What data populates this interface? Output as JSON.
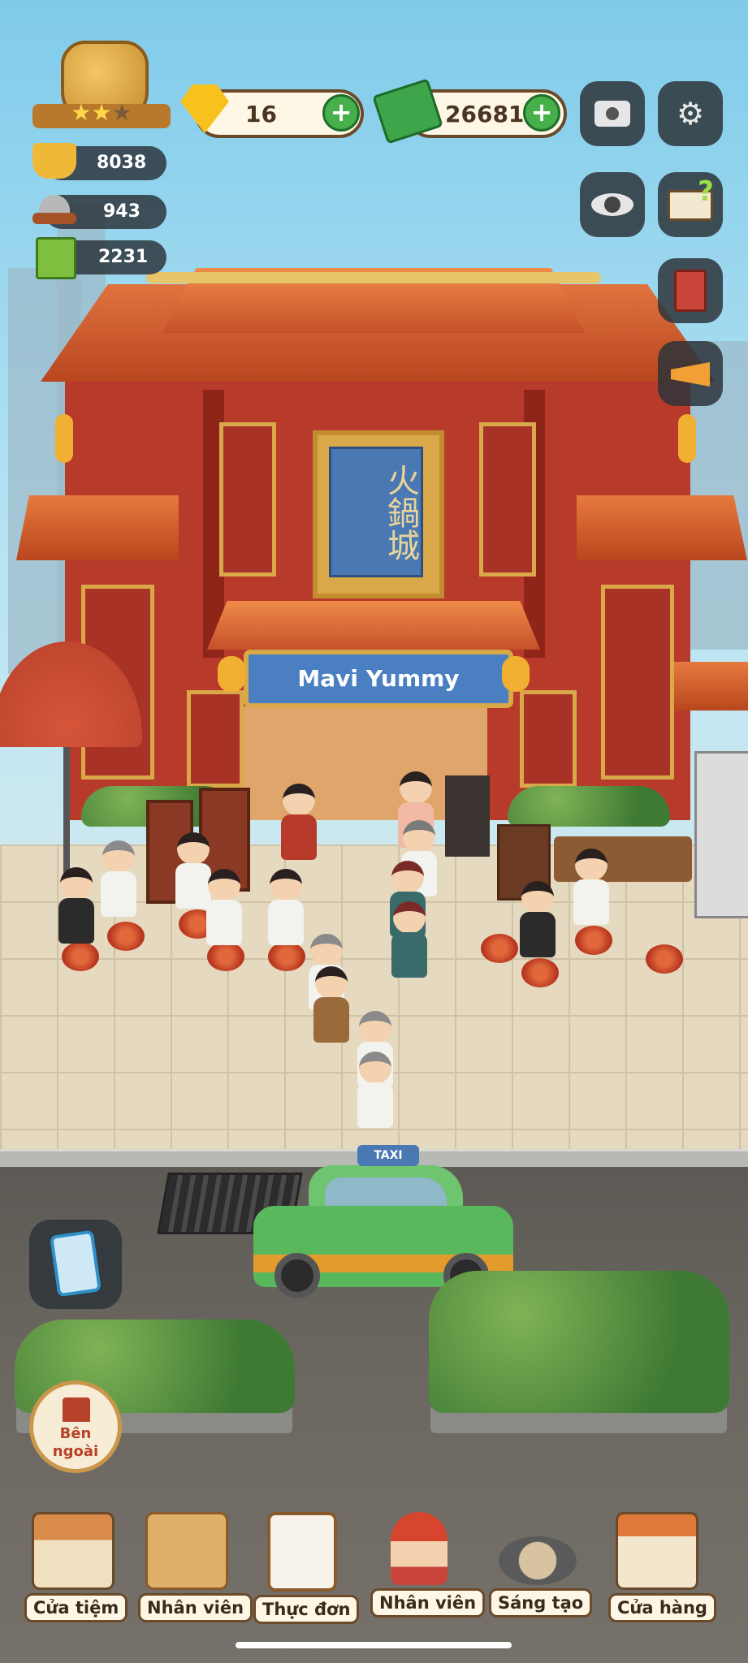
{
  "hud": {
    "diamonds": "16",
    "cash": "26681",
    "stat_hotpot": "8038",
    "stat_dish": "943",
    "stat_recipes": "2231"
  },
  "restaurant": {
    "name": "Mavi Yummy",
    "plaque": "火鍋城"
  },
  "taxi_label": "TAXI",
  "outside_button": {
    "label_line1": "Bên",
    "label_line2": "ngoài"
  },
  "bottom_nav": [
    {
      "label": "Cửa tiệm",
      "icon": "shop-building-icon"
    },
    {
      "label": "Nhân viên",
      "icon": "boxes-icon"
    },
    {
      "label": "Thực đơn",
      "icon": "clipboard-checklist-icon"
    },
    {
      "label": "Nhân viên",
      "icon": "chef-girl-icon"
    },
    {
      "label": "Sáng tạo",
      "icon": "cooking-wok-icon"
    },
    {
      "label": "Cửa hàng",
      "icon": "storefront-icon"
    }
  ],
  "colors": {
    "accent_green": "#47b04b",
    "wall_red": "#b83a2b",
    "sign_blue": "#4a7fc1",
    "gold": "#d9a848"
  }
}
